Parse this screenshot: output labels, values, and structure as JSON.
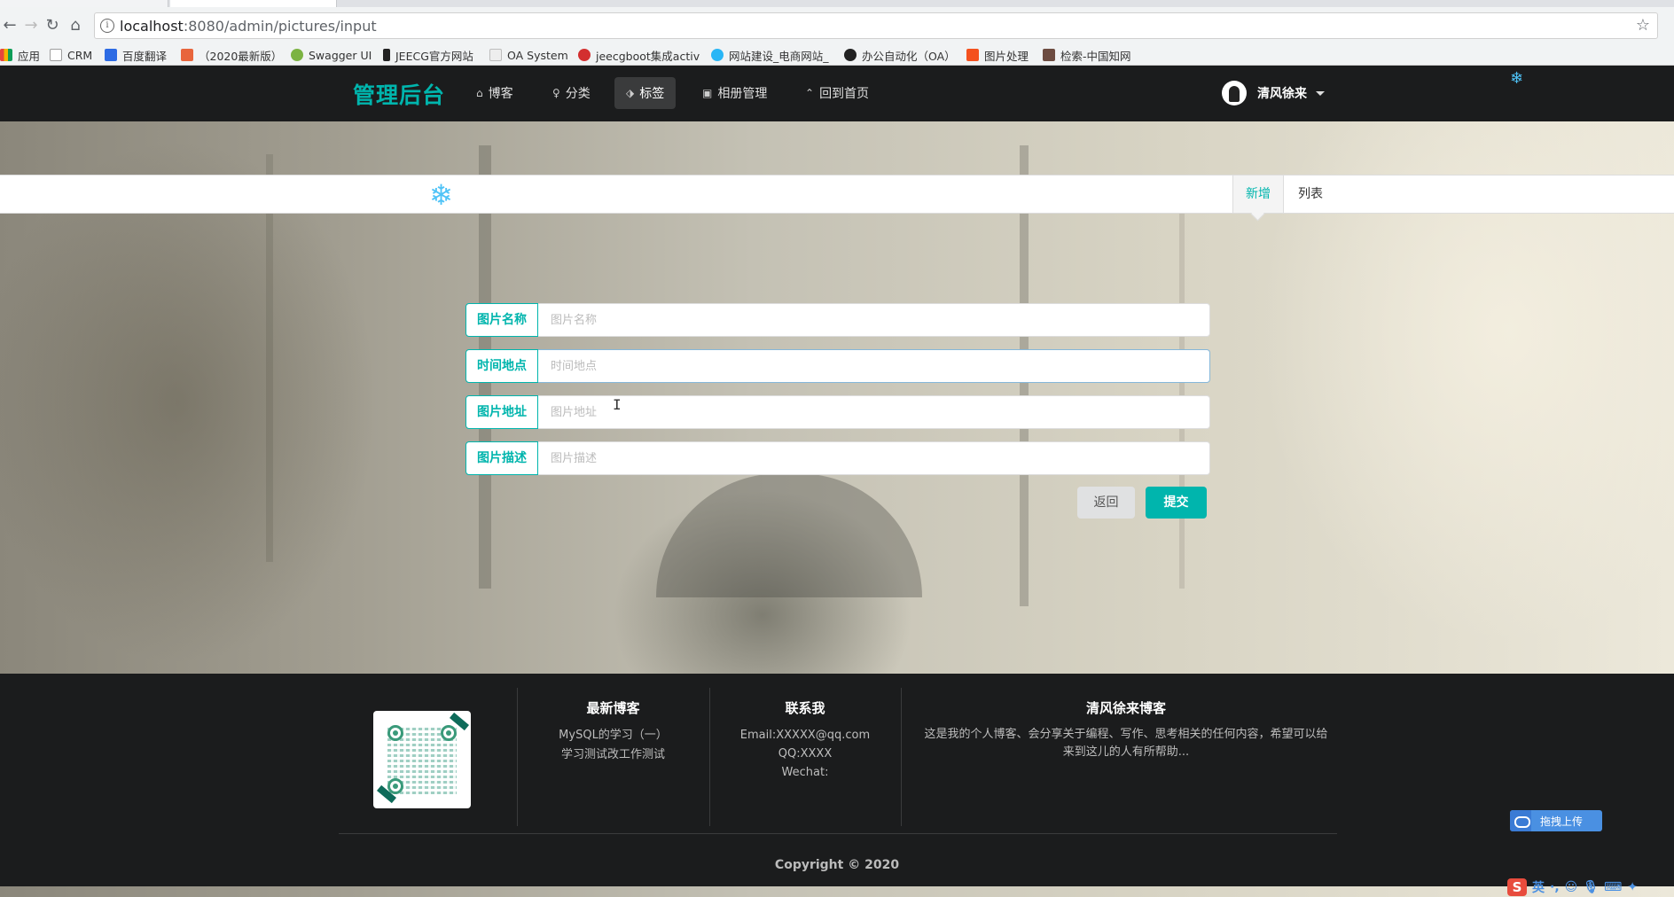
{
  "browser": {
    "url_host": "localhost",
    "url_path": ":8080/admin/pictures/input",
    "bookmarks": [
      {
        "label": "应用",
        "color": "#e8453c"
      },
      {
        "label": "CRM",
        "color": "#9e9e9e"
      },
      {
        "label": "百度翻译",
        "color": "#2d6be4"
      },
      {
        "label": "（2020最新版）",
        "color": "#e8653c"
      },
      {
        "label": "Swagger UI",
        "color": "#7cb342"
      },
      {
        "label": "JEECG官方网站",
        "color": "#222222"
      },
      {
        "label": "OA System",
        "color": "#bdbdbd"
      },
      {
        "label": "jeecgboot集成activ",
        "color": "#d32f2f"
      },
      {
        "label": "网站建设_电商网站_",
        "color": "#29b6f6"
      },
      {
        "label": "办公自动化（OA）",
        "color": "#222222"
      },
      {
        "label": "图片处理",
        "color": "#f4511e"
      },
      {
        "label": "检索-中国知网",
        "color": "#6d4c41"
      }
    ]
  },
  "nav": {
    "brand": "管理后台",
    "items": [
      {
        "label": "博客",
        "icon": "home-icon",
        "glyph": "⌂"
      },
      {
        "label": "分类",
        "icon": "lightbulb-icon",
        "glyph": "♀"
      },
      {
        "label": "标签",
        "icon": "tags-icon",
        "glyph": "⬗"
      },
      {
        "label": "相册管理",
        "icon": "image-icon",
        "glyph": "▣"
      },
      {
        "label": "回到首页",
        "icon": "angle-double-up-icon",
        "glyph": "⌃"
      }
    ],
    "user": "清风徐来"
  },
  "subnav": {
    "tabs": [
      {
        "label": "新增"
      },
      {
        "label": "列表"
      }
    ]
  },
  "form": {
    "fields": [
      {
        "label": "图片名称",
        "placeholder": "图片名称",
        "value": ""
      },
      {
        "label": "时间地点",
        "placeholder": "时间地点",
        "value": ""
      },
      {
        "label": "图片地址",
        "placeholder": "图片地址",
        "value": ""
      },
      {
        "label": "图片描述",
        "placeholder": "图片描述",
        "value": ""
      }
    ],
    "back_label": "返回",
    "submit_label": "提交"
  },
  "footer": {
    "latest": {
      "title": "最新博客",
      "items": [
        "MySQL的学习（一）",
        "学习测试改工作测试"
      ]
    },
    "contact": {
      "title": "联系我",
      "items": [
        "Email:XXXXX@qq.com",
        "QQ:XXXX",
        "Wechat:"
      ]
    },
    "about": {
      "title": "清风徐来博客",
      "text": "这是我的个人博客、会分享关于编程、写作、思考相关的任何内容，希望可以给来到这儿的人有所帮助..."
    },
    "copyright": "Copyright © 2020"
  },
  "widgets": {
    "upload_label": "拖拽上传",
    "ime_label": "英"
  },
  "colors": {
    "accent": "#00b5ad",
    "nav_bg": "#1b1c1d"
  }
}
